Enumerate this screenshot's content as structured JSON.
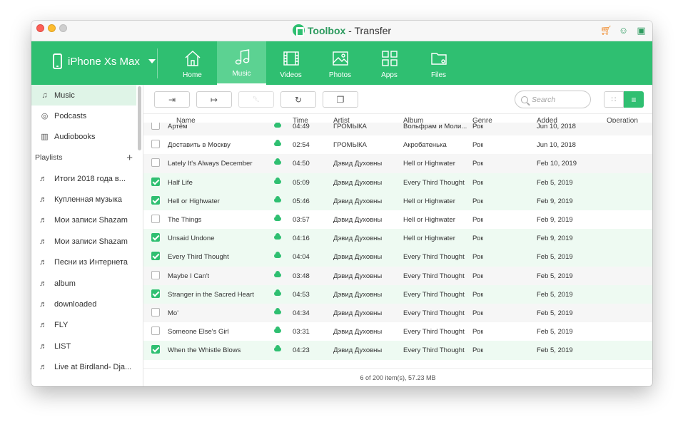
{
  "window": {
    "brand": "Toolbox",
    "title_suffix": " - Transfer"
  },
  "device": {
    "name": "iPhone Xs Max"
  },
  "nav": [
    {
      "label": "Home",
      "icon": "home-icon"
    },
    {
      "label": "Music",
      "icon": "music-icon",
      "active": true
    },
    {
      "label": "Videos",
      "icon": "film-icon"
    },
    {
      "label": "Photos",
      "icon": "photo-icon"
    },
    {
      "label": "Apps",
      "icon": "apps-icon"
    },
    {
      "label": "Files",
      "icon": "folder-icon"
    }
  ],
  "sidebar": {
    "categories": [
      {
        "label": "Music",
        "icon": "music-note-icon",
        "active": true
      },
      {
        "label": "Podcasts",
        "icon": "podcast-icon"
      },
      {
        "label": "Audiobooks",
        "icon": "book-icon"
      }
    ],
    "playlists_label": "Playlists",
    "playlists": [
      "Итоги 2018 года в...",
      "Купленная музыка",
      "Мои записи Shazam",
      "Мои записи Shazam",
      "Песни из Интернета",
      "album",
      "downloaded",
      "FLY",
      "LIST",
      "Live at Birdland- Dja..."
    ]
  },
  "search": {
    "placeholder": "Search"
  },
  "table": {
    "columns": [
      "Name",
      "Time",
      "Artist",
      "Album",
      "Genre",
      "Added",
      "Operation"
    ],
    "rows": [
      {
        "name": "Артём",
        "time": "04:49",
        "artist": "ГРОМЫКА",
        "album": "Вольфрам и Моли...",
        "genre": "Рок",
        "added": "Jun 10, 2018",
        "checked": false
      },
      {
        "name": "Доставить в Москву",
        "time": "02:54",
        "artist": "ГРОМЫКА",
        "album": "Акробатенька",
        "genre": "Рок",
        "added": "Jun 10, 2018",
        "checked": false
      },
      {
        "name": "Lately It's Always December",
        "time": "04:50",
        "artist": "Дэвид Духовны",
        "album": "Hell or Highwater",
        "genre": "Рок",
        "added": "Feb 10, 2019",
        "checked": false
      },
      {
        "name": "Half Life",
        "time": "05:09",
        "artist": "Дэвид Духовны",
        "album": "Every Third Thought",
        "genre": "Рок",
        "added": "Feb 5, 2019",
        "checked": true
      },
      {
        "name": "Hell or Highwater",
        "time": "05:46",
        "artist": "Дэвид Духовны",
        "album": "Hell or Highwater",
        "genre": "Рок",
        "added": "Feb 9, 2019",
        "checked": true
      },
      {
        "name": "The Things",
        "time": "03:57",
        "artist": "Дэвид Духовны",
        "album": "Hell or Highwater",
        "genre": "Рок",
        "added": "Feb 9, 2019",
        "checked": false
      },
      {
        "name": "Unsaid Undone",
        "time": "04:16",
        "artist": "Дэвид Духовны",
        "album": "Hell or Highwater",
        "genre": "Рок",
        "added": "Feb 9, 2019",
        "checked": true
      },
      {
        "name": "Every Third Thought",
        "time": "04:04",
        "artist": "Дэвид Духовны",
        "album": "Every Third Thought",
        "genre": "Рок",
        "added": "Feb 5, 2019",
        "checked": true
      },
      {
        "name": "Maybe I Can't",
        "time": "03:48",
        "artist": "Дэвид Духовны",
        "album": "Every Third Thought",
        "genre": "Рок",
        "added": "Feb 5, 2019",
        "checked": false
      },
      {
        "name": "Stranger in the Sacred Heart",
        "time": "04:53",
        "artist": "Дэвид Духовны",
        "album": "Every Third Thought",
        "genre": "Рок",
        "added": "Feb 5, 2019",
        "checked": true
      },
      {
        "name": "Mo'",
        "time": "04:34",
        "artist": "Дэвид Духовны",
        "album": "Every Third Thought",
        "genre": "Рок",
        "added": "Feb 5, 2019",
        "checked": false
      },
      {
        "name": "Someone Else's Girl",
        "time": "03:31",
        "artist": "Дэвид Духовны",
        "album": "Every Third Thought",
        "genre": "Рок",
        "added": "Feb 5, 2019",
        "checked": false
      },
      {
        "name": "When the Whistle Blows",
        "time": "04:23",
        "artist": "Дэвид Духовны",
        "album": "Every Third Thought",
        "genre": "Рок",
        "added": "Feb 5, 2019",
        "checked": true
      }
    ]
  },
  "status": {
    "text": "6 of 200 item(s), 57.23 MB"
  },
  "colors": {
    "accent": "#2fbf71",
    "accent_light": "#5cd292",
    "selected_row": "#eefaf2",
    "cart": "#f08a2a"
  }
}
